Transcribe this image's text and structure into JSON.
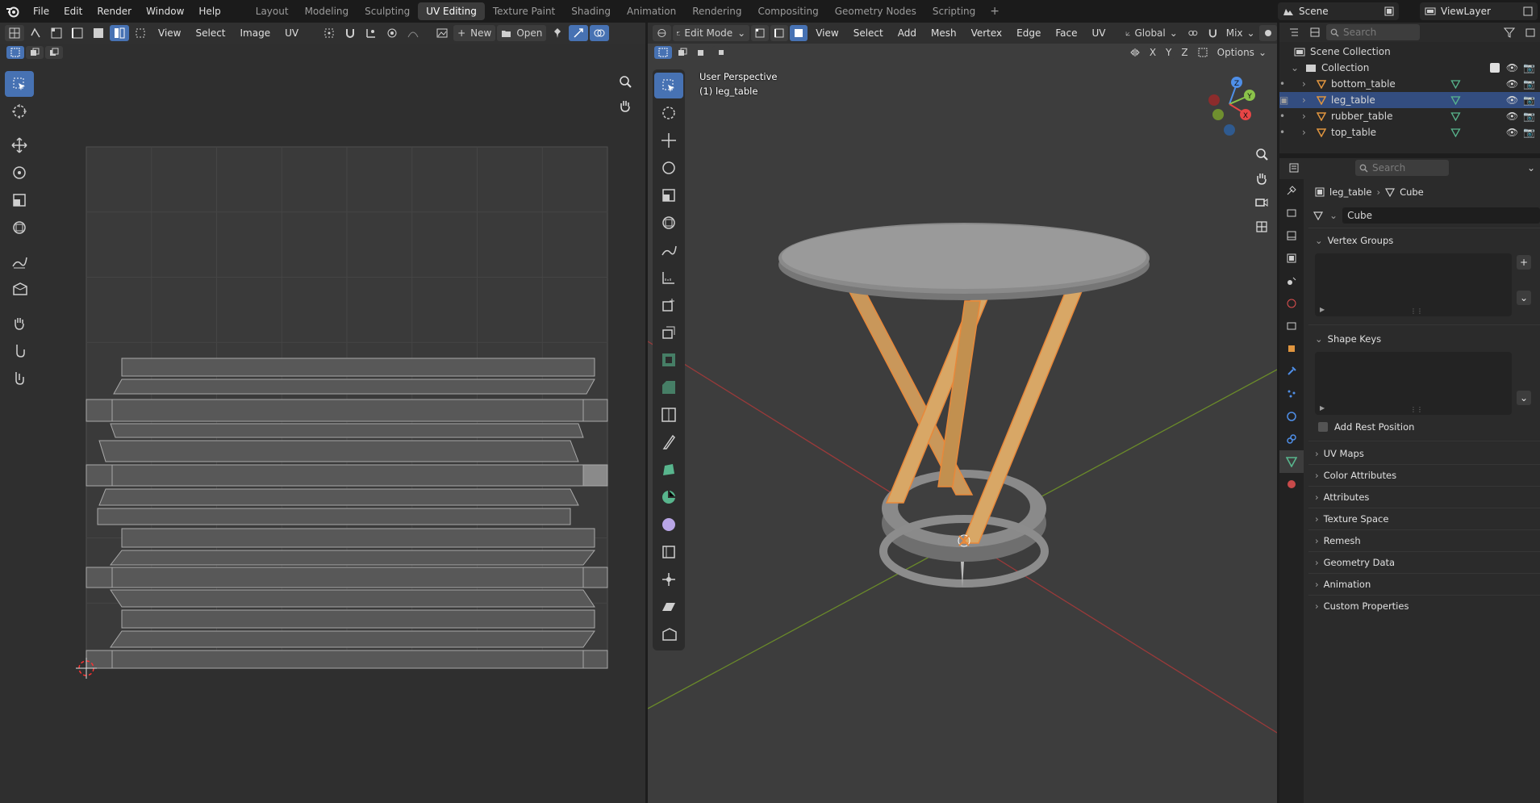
{
  "topbar": {
    "menus": [
      "File",
      "Edit",
      "Render",
      "Window",
      "Help"
    ],
    "workspaces": [
      "Layout",
      "Modeling",
      "Sculpting",
      "UV Editing",
      "Texture Paint",
      "Shading",
      "Animation",
      "Rendering",
      "Compositing",
      "Geometry Nodes",
      "Scripting"
    ],
    "active_workspace": "UV Editing",
    "add_workspace": "+",
    "scene": "Scene",
    "view_layer": "ViewLayer"
  },
  "uv_editor": {
    "menus": [
      "View",
      "Select",
      "Image",
      "UV"
    ],
    "new_label": "New",
    "open_label": "Open"
  },
  "viewport": {
    "mode": "Edit Mode",
    "menus": [
      "View",
      "Select",
      "Add",
      "Mesh",
      "Vertex",
      "Edge",
      "Face",
      "UV"
    ],
    "orientation": "Global",
    "proportional": "Mix",
    "options_label": "Options",
    "axes": [
      "X",
      "Y",
      "Z"
    ],
    "info_line1": "User Perspective",
    "info_line2": "(1) leg_table"
  },
  "outliner": {
    "search_placeholder": "Search",
    "scene_collection": "Scene Collection",
    "collection": "Collection",
    "objects": [
      {
        "name": "bottom_table",
        "selected": false
      },
      {
        "name": "leg_table",
        "selected": true
      },
      {
        "name": "rubber_table",
        "selected": false
      },
      {
        "name": "top_table",
        "selected": false
      }
    ]
  },
  "properties": {
    "search_placeholder": "Search",
    "breadcrumb_object": "leg_table",
    "breadcrumb_data": "Cube",
    "mesh_name": "Cube",
    "panels_open": [
      "Vertex Groups",
      "Shape Keys"
    ],
    "add_rest_position": "Add Rest Position",
    "panels_closed": [
      "UV Maps",
      "Color Attributes",
      "Attributes",
      "Texture Space",
      "Remesh",
      "Geometry Data",
      "Animation",
      "Custom Properties"
    ]
  },
  "colors": {
    "accent": "#4772b3",
    "selected_row": "#334d80",
    "selection_orange": "#e8883a",
    "mesh_object": "#e0953f",
    "data_green": "#58b58d"
  }
}
